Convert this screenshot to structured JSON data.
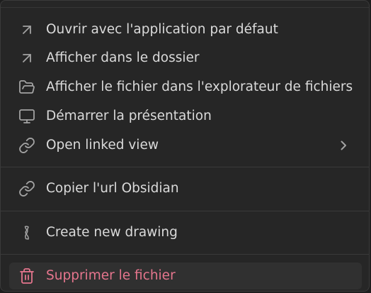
{
  "menu": {
    "items": [
      {
        "label": "Ouvrir avec l'application par défaut",
        "icon": "arrow-up-right-icon"
      },
      {
        "label": "Afficher dans le dossier",
        "icon": "arrow-up-right-icon"
      },
      {
        "label": "Afficher le fichier dans l'explorateur de fichiers",
        "icon": "folder-open-icon"
      },
      {
        "label": "Démarrer la présentation",
        "icon": "monitor-icon"
      },
      {
        "label": "Open linked view",
        "icon": "link-icon",
        "submenu": "chevron-right-icon"
      },
      {
        "label": "Copier l'url Obsidian",
        "icon": "link-icon"
      },
      {
        "label": "Create new drawing",
        "icon": "excalidraw-icon"
      },
      {
        "label": "Supprimer le fichier",
        "icon": "trash-icon"
      }
    ]
  },
  "colors": {
    "background": "#262626",
    "text": "#dadada",
    "icon": "#a3a3a3",
    "danger": "#e5758d",
    "hover": "#303030"
  }
}
